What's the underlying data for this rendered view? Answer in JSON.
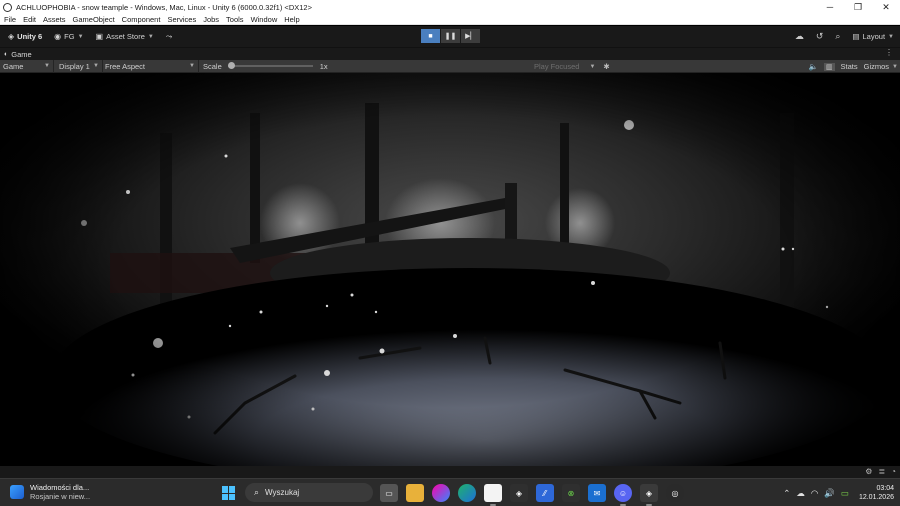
{
  "window": {
    "title": "ACHLUOPHOBIA - snow teample - Windows, Mac, Linux - Unity 6 (6000.0.32f1) <DX12>",
    "minimize": "─",
    "restore": "❐",
    "close": "✕"
  },
  "menu": [
    "File",
    "Edit",
    "Assets",
    "GameObject",
    "Component",
    "Services",
    "Jobs",
    "Tools",
    "Window",
    "Help"
  ],
  "toolbar": {
    "unity_label": "Unity 6",
    "account_label": "FG",
    "asset_store_label": "Asset Store",
    "layout_label": "Layout"
  },
  "tab": {
    "game_label": "Game"
  },
  "gameview": {
    "mode": "Game",
    "display": "Display 1",
    "aspect": "Free Aspect",
    "scale_label": "Scale",
    "scale_value": "1x",
    "scale_fraction": 0.0,
    "play_mode": "Play Focused",
    "stats_label": "Stats",
    "gizmos_label": "Gizmos"
  },
  "taskbar": {
    "widget_title": "Wiadomości dla...",
    "widget_sub": "Rosjanie w niew...",
    "search_placeholder": "Wyszukaj",
    "time": "03:04",
    "date": "12.01.2026"
  },
  "colors": {
    "play_active": "#4a7fbf",
    "toolbar_bg": "#191919",
    "gamebar_bg": "#383838",
    "taskbar_bg": "#2b2b2b",
    "accent_windows": "#4cc2ff"
  }
}
